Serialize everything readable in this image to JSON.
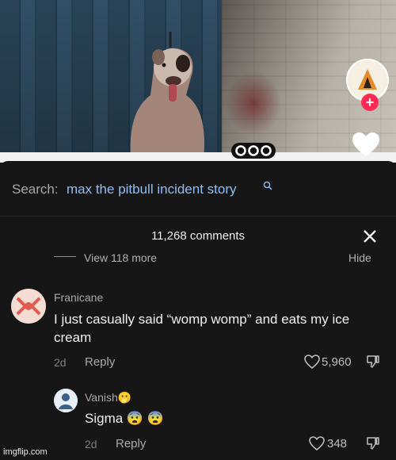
{
  "search": {
    "label": "Search:",
    "query": "max the pitbull incident story"
  },
  "comments": {
    "count_label": "11,268 comments",
    "view_more_label": "View 118 more",
    "hide_label": "Hide",
    "items": [
      {
        "username": "Franicane",
        "text": "I just casually said “womp womp” and eats my ice cream",
        "age": "2d",
        "reply_label": "Reply",
        "likes": "5,960"
      },
      {
        "username": "Vanish",
        "username_emoji": "🫢",
        "text": "Sigma 😨 😨",
        "age": "2d",
        "reply_label": "Reply",
        "likes": "348"
      }
    ]
  },
  "video": {
    "icons": [
      "more-dots-icon",
      "heart-icon",
      "follow-plus-icon"
    ]
  },
  "watermark": "imgflip.com",
  "colors": {
    "accent": "#fe2c55",
    "link": "#8fbef7",
    "panel_bg": "#161616"
  }
}
